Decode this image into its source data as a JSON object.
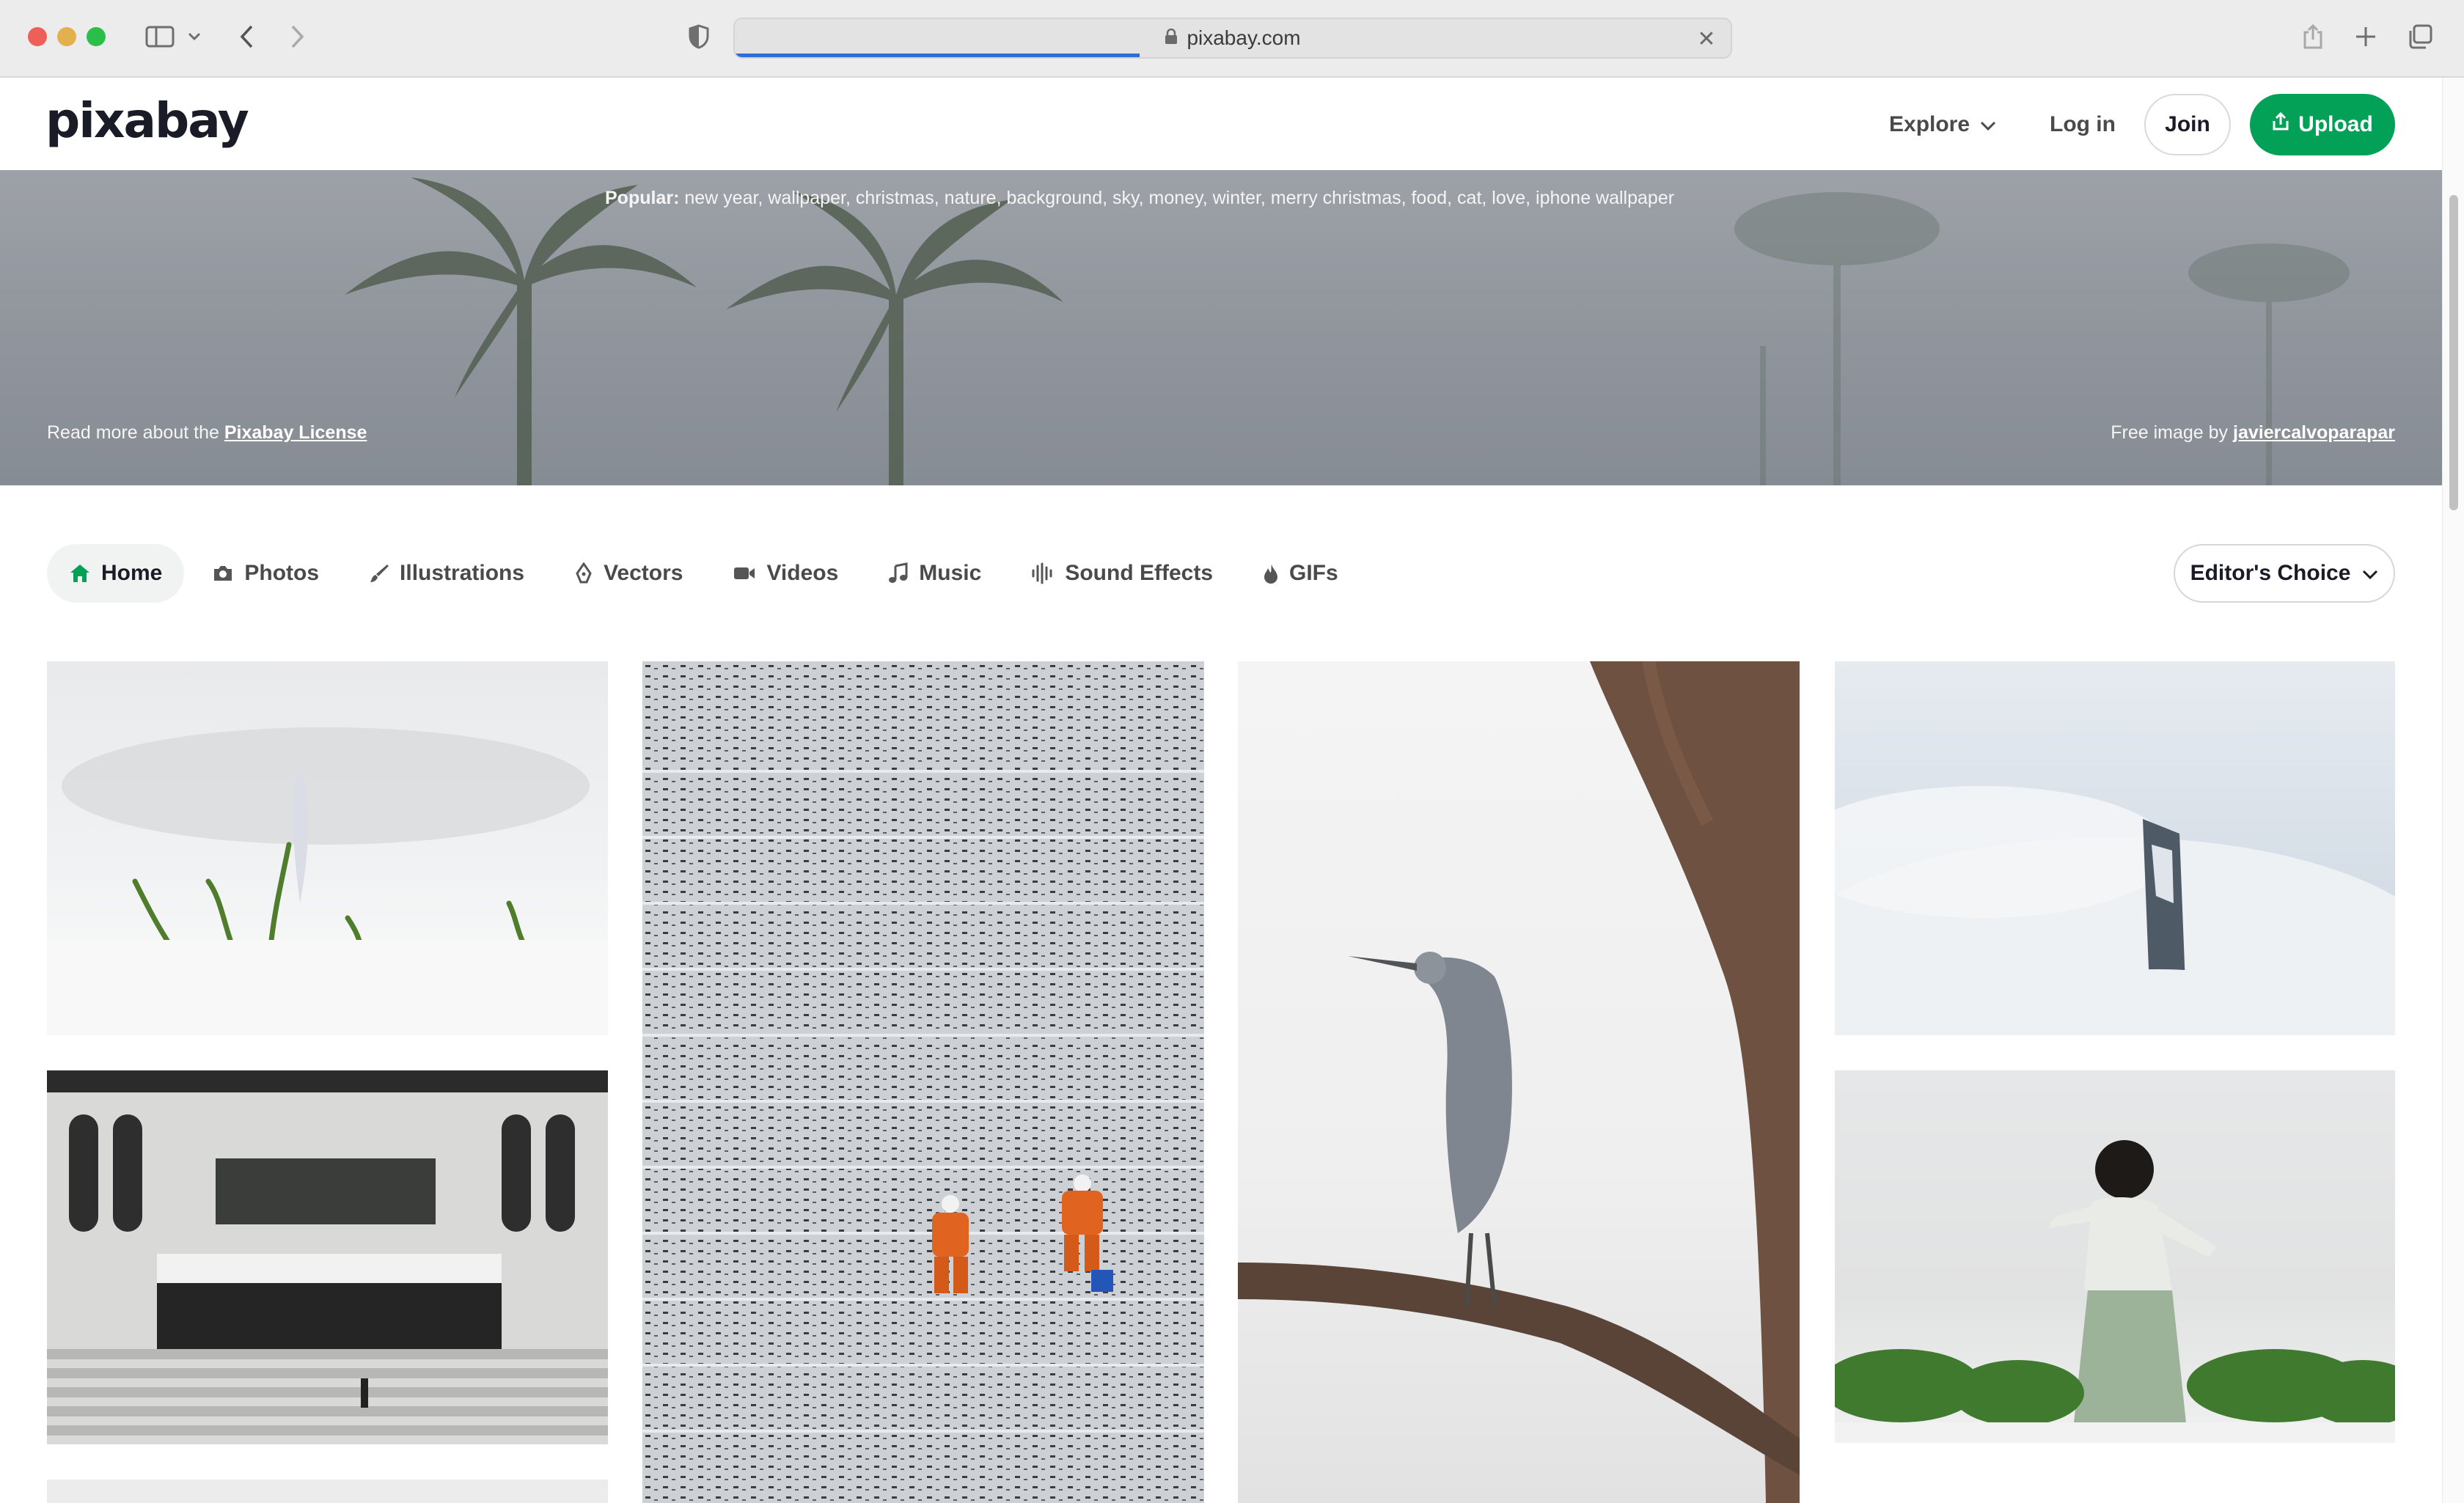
{
  "browser": {
    "url": "pixabay.com"
  },
  "header": {
    "logo": "pixabay",
    "explore": "Explore",
    "login": "Log in",
    "join": "Join",
    "upload": "Upload"
  },
  "hero": {
    "popular_label": "Popular:",
    "popular_terms": "new year, wallpaper, christmas, nature, background, sky, money, winter, merry christmas, food, cat, love, iphone wallpaper",
    "license_prefix": "Read more about the",
    "license_link": "Pixabay License",
    "credit_prefix": "Free image by",
    "credit_author": "javiercalvoparapar"
  },
  "tabs": [
    {
      "label": "Home",
      "icon": "home-icon",
      "active": true
    },
    {
      "label": "Photos",
      "icon": "camera-icon"
    },
    {
      "label": "Illustrations",
      "icon": "brush-icon"
    },
    {
      "label": "Vectors",
      "icon": "pen-nib-icon"
    },
    {
      "label": "Videos",
      "icon": "video-camera-icon"
    },
    {
      "label": "Music",
      "icon": "music-note-icon"
    },
    {
      "label": "Sound Effects",
      "icon": "waveform-icon"
    },
    {
      "label": "GIFs",
      "icon": "flame-icon"
    }
  ],
  "filter": {
    "label": "Editor's Choice"
  },
  "colors": {
    "brand_green": "#02a157",
    "progress_blue": "#2d6fd6"
  }
}
